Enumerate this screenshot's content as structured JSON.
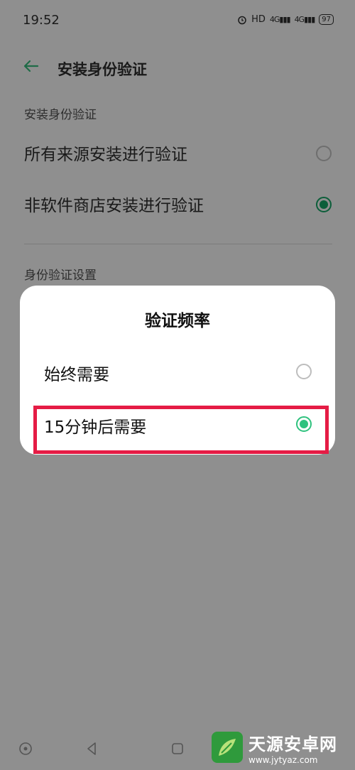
{
  "status_bar": {
    "time": "19:52",
    "hd": "HD",
    "net1": "4G",
    "net2": "4G",
    "battery": "97"
  },
  "header": {
    "title": "安装身份验证"
  },
  "section1": {
    "label": "安装身份验证",
    "options": [
      {
        "label": "所有来源安装进行验证",
        "selected": false
      },
      {
        "label": "非软件商店安装进行验证",
        "selected": true
      }
    ]
  },
  "section2": {
    "label": "身份验证设置"
  },
  "dialog": {
    "title": "验证频率",
    "options": [
      {
        "label": "始终需要",
        "selected": false
      },
      {
        "label": "15分钟后需要",
        "selected": true
      }
    ]
  },
  "watermark": {
    "name": "天源安卓网",
    "url": "www.jytyaz.com"
  },
  "colors": {
    "accent": "#2fc27e",
    "highlight": "#e51c45",
    "dim_overlay": "#8f8f8f"
  }
}
